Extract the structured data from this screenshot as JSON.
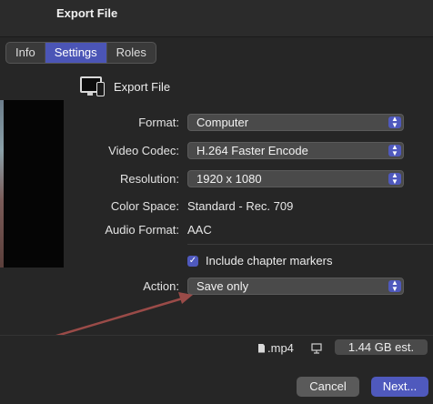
{
  "window": {
    "title": "Export File"
  },
  "tabs": [
    {
      "label": "Info",
      "active": false
    },
    {
      "label": "Settings",
      "active": true
    },
    {
      "label": "Roles",
      "active": false
    }
  ],
  "destination": {
    "label": "Export File",
    "icon": "computer-and-phone-icon"
  },
  "settings": {
    "format": {
      "label": "Format:",
      "value": "Computer"
    },
    "video_codec": {
      "label": "Video Codec:",
      "value": "H.264 Faster Encode"
    },
    "resolution": {
      "label": "Resolution:",
      "value": "1920 x 1080"
    },
    "color_space": {
      "label": "Color Space:",
      "value": "Standard - Rec. 709"
    },
    "audio_format": {
      "label": "Audio Format:",
      "value": "AAC"
    },
    "chapter_markers": {
      "label": "Include chapter markers",
      "checked": true
    },
    "action": {
      "label": "Action:",
      "value": "Save only"
    }
  },
  "info": {
    "file_extension": ".mp4",
    "estimated_size": "1.44 GB est."
  },
  "buttons": {
    "cancel": "Cancel",
    "next": "Next..."
  },
  "colors": {
    "accent": "#4f59bd",
    "annotation_arrow": "#9a4b48",
    "background": "#262626"
  }
}
